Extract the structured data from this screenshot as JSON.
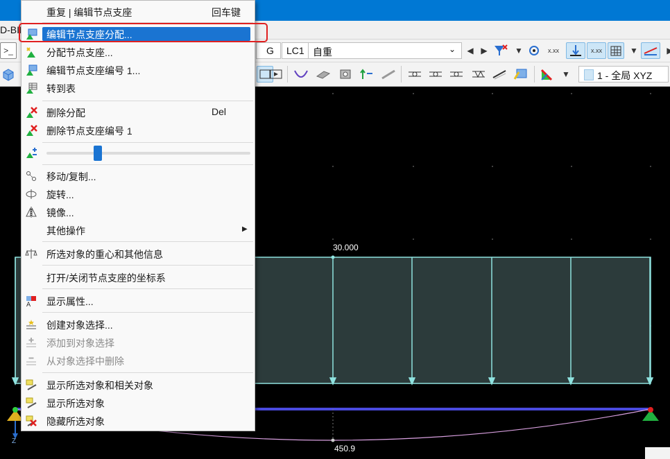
{
  "menubar": {
    "partial_text": "D-BIM"
  },
  "toolbar1": {
    "load_group": "G",
    "load_case": "LC1",
    "load_case_name": "自重"
  },
  "toolbar2": {
    "view_coordinate_system": "1 - 全局 XYZ"
  },
  "canvas": {
    "load_value_label": "30.000",
    "deflection_label": "450.9",
    "axis_label_z": "Z"
  },
  "context_menu": {
    "items": [
      {
        "label": "重复 | 编辑节点支座",
        "shortcut": "回车键",
        "icon": "repeat-icon",
        "enabled": true
      },
      {
        "label": "编辑节点支座分配...",
        "shortcut": "",
        "icon": "edit-support-icon",
        "enabled": true,
        "highlighted": true
      },
      {
        "label": "分配节点支座...",
        "shortcut": "",
        "icon": "assign-support-icon",
        "enabled": true
      },
      {
        "label": "编辑节点支座编号 1...",
        "shortcut": "",
        "icon": "edit-support-number-icon",
        "enabled": true
      },
      {
        "label": "转到表",
        "shortcut": "",
        "icon": "table-icon",
        "enabled": true
      },
      {
        "label": "删除分配",
        "shortcut": "Del",
        "icon": "delete-assignment-icon",
        "enabled": true
      },
      {
        "label": "删除节点支座编号 1",
        "shortcut": "",
        "icon": "delete-support-icon",
        "enabled": true
      },
      {
        "label": "移动/复制...",
        "shortcut": "",
        "icon": "move-copy-icon",
        "enabled": true
      },
      {
        "label": "旋转...",
        "shortcut": "",
        "icon": "rotate-icon",
        "enabled": true
      },
      {
        "label": "镜像...",
        "shortcut": "",
        "icon": "mirror-icon",
        "enabled": true
      },
      {
        "label": "其他操作",
        "shortcut": "",
        "icon": "",
        "enabled": true,
        "submenu": true
      },
      {
        "label": "所选对象的重心和其他信息",
        "shortcut": "",
        "icon": "balance-icon",
        "enabled": true
      },
      {
        "label": "打开/关闭节点支座的坐标系",
        "shortcut": "",
        "icon": "",
        "enabled": true
      },
      {
        "label": "显示属性...",
        "shortcut": "",
        "icon": "display-properties-icon",
        "enabled": true
      },
      {
        "label": "创建对象选择...",
        "shortcut": "",
        "icon": "create-selection-icon",
        "enabled": true
      },
      {
        "label": "添加到对象选择",
        "shortcut": "",
        "icon": "add-to-selection-icon",
        "enabled": false
      },
      {
        "label": "从对象选择中删除",
        "shortcut": "",
        "icon": "remove-from-selection-icon",
        "enabled": false
      },
      {
        "label": "显示所选对象和相关对象",
        "shortcut": "",
        "icon": "show-related-icon",
        "enabled": true
      },
      {
        "label": "显示所选对象",
        "shortcut": "",
        "icon": "show-selected-icon",
        "enabled": true
      },
      {
        "label": "隐藏所选对象",
        "shortcut": "",
        "icon": "hide-selected-icon",
        "enabled": true
      }
    ],
    "slider_value": 0.26
  },
  "colors": {
    "highlight": "#1a74d2",
    "red_annotation": "#e02020",
    "load_fill": "#2c3b3b",
    "load_line": "#8fe3e0",
    "member_line": "#4a4adf",
    "deflection_line": "#d9a0e0"
  }
}
